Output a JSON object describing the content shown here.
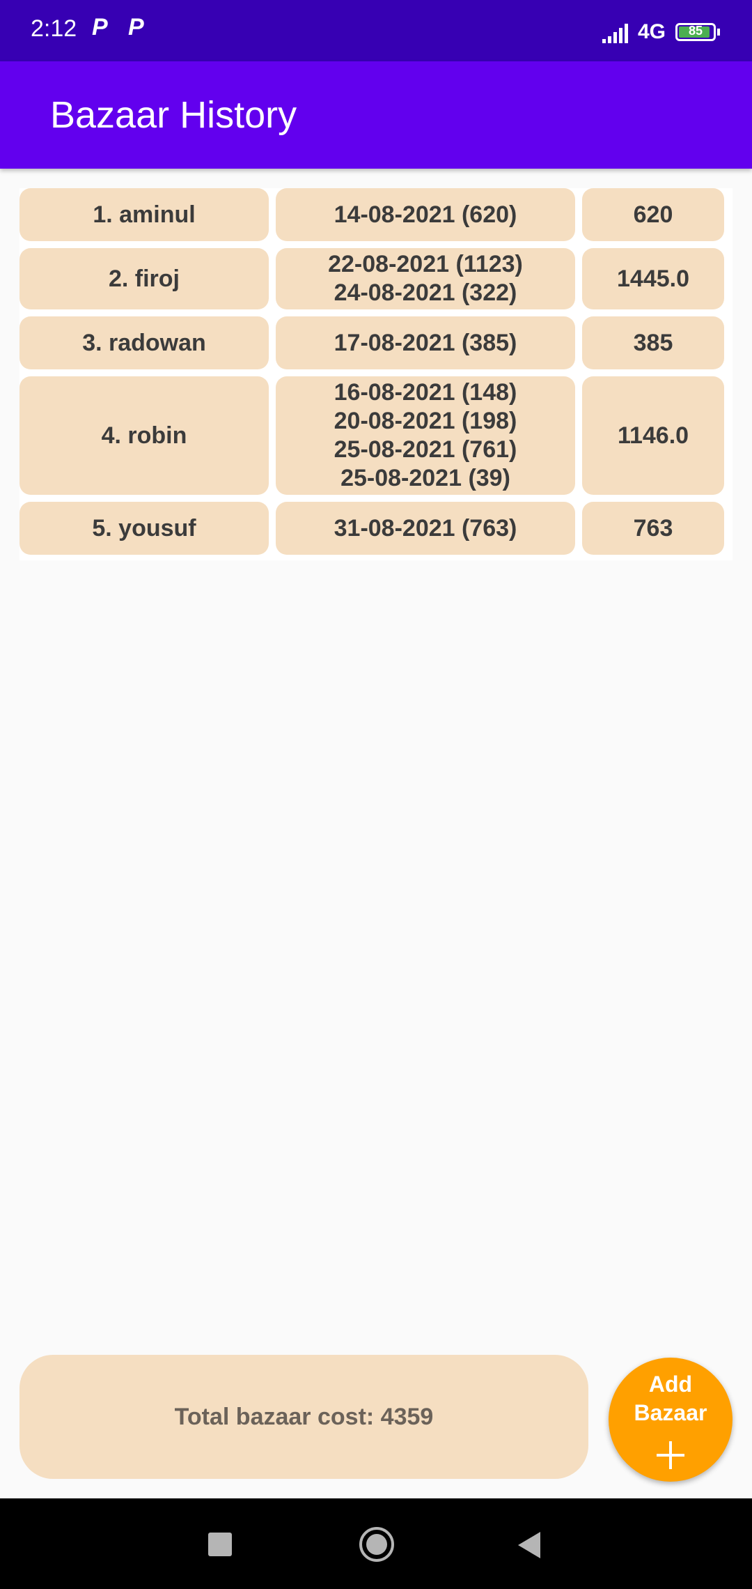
{
  "status_bar": {
    "time": "2:12",
    "notif_icons": [
      "P",
      "P"
    ],
    "network": "4G",
    "battery": "85"
  },
  "app_bar": {
    "title": "Bazaar History"
  },
  "history": {
    "rows": [
      {
        "name": "1. aminul",
        "dates": [
          "14-08-2021 (620)"
        ],
        "total": "620"
      },
      {
        "name": "2. firoj",
        "dates": [
          "22-08-2021 (1123)",
          "24-08-2021 (322)"
        ],
        "total": "1445.0"
      },
      {
        "name": "3. radowan",
        "dates": [
          "17-08-2021 (385)"
        ],
        "total": "385"
      },
      {
        "name": "4. robin",
        "dates": [
          "16-08-2021 (148)",
          "20-08-2021 (198)",
          "25-08-2021 (761)",
          "25-08-2021 (39)"
        ],
        "total": "1146.0"
      },
      {
        "name": "5. yousuf",
        "dates": [
          "31-08-2021 (763)"
        ],
        "total": "763"
      }
    ]
  },
  "footer": {
    "total_label": "Total bazaar cost: 4359",
    "fab_line1": "Add",
    "fab_line2": "Bazaar"
  },
  "colors": {
    "status_bar": "#3700b3",
    "app_bar": "#6200ee",
    "cell_bg": "#f5dec1",
    "fab": "#ffa000"
  },
  "icons": {
    "fab": "plus-icon",
    "nav": [
      "recents-icon",
      "home-icon",
      "back-icon"
    ]
  }
}
